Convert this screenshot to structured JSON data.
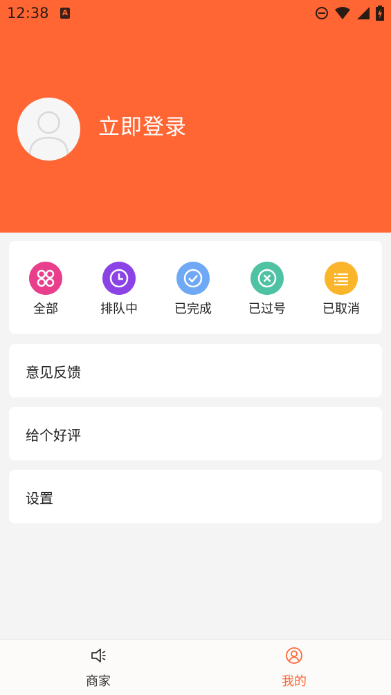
{
  "status_bar": {
    "time": "12:38",
    "badge": "A",
    "icons": [
      "do-not-disturb-icon",
      "wifi-icon",
      "signal-icon",
      "battery-charging-icon"
    ]
  },
  "profile": {
    "login_label": "立即登录"
  },
  "orders": [
    {
      "label": "全部",
      "icon": "grid-icon",
      "color": "#e83e8c"
    },
    {
      "label": "排队中",
      "icon": "clock-icon",
      "color": "#8b43e6"
    },
    {
      "label": "已完成",
      "icon": "check-circle-icon",
      "color": "#6fa8f5"
    },
    {
      "label": "已过号",
      "icon": "cross-circle-icon",
      "color": "#4fc2a4"
    },
    {
      "label": "已取消",
      "icon": "list-icon",
      "color": "#fbb52b"
    }
  ],
  "menu": {
    "feedback": "意见反馈",
    "rate": "给个好评",
    "settings": "设置"
  },
  "bottom_nav": {
    "merchants": "商家",
    "mine": "我的",
    "active_color": "#ff6633",
    "inactive_color": "#333333"
  },
  "colors": {
    "brand": "#ff6633",
    "background": "#f4f4f4"
  }
}
